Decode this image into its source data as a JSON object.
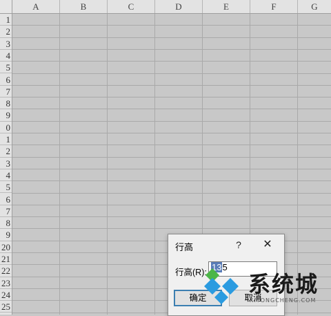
{
  "columns": [
    "A",
    "B",
    "C",
    "D",
    "E",
    "F",
    "G"
  ],
  "rows": [
    "1",
    "2",
    "3",
    "4",
    "5",
    "6",
    "7",
    "8",
    "9",
    "0",
    "1",
    "2",
    "3",
    "4",
    "5",
    "6",
    "7",
    "8",
    "9",
    "20",
    "21",
    "22",
    "23",
    "24",
    "25"
  ],
  "dialog": {
    "title": "行高",
    "help_label": "?",
    "close_label": "✕",
    "field_label": "行高(R):",
    "field_value_selected": "13",
    "field_value_rest": "5",
    "ok_label": "确定",
    "cancel_label": "取消"
  },
  "watermark": {
    "title": "系统城",
    "subtitle": "XITONGCHENG.COM",
    "colors": [
      "#2b9be0",
      "#4cb648"
    ]
  }
}
